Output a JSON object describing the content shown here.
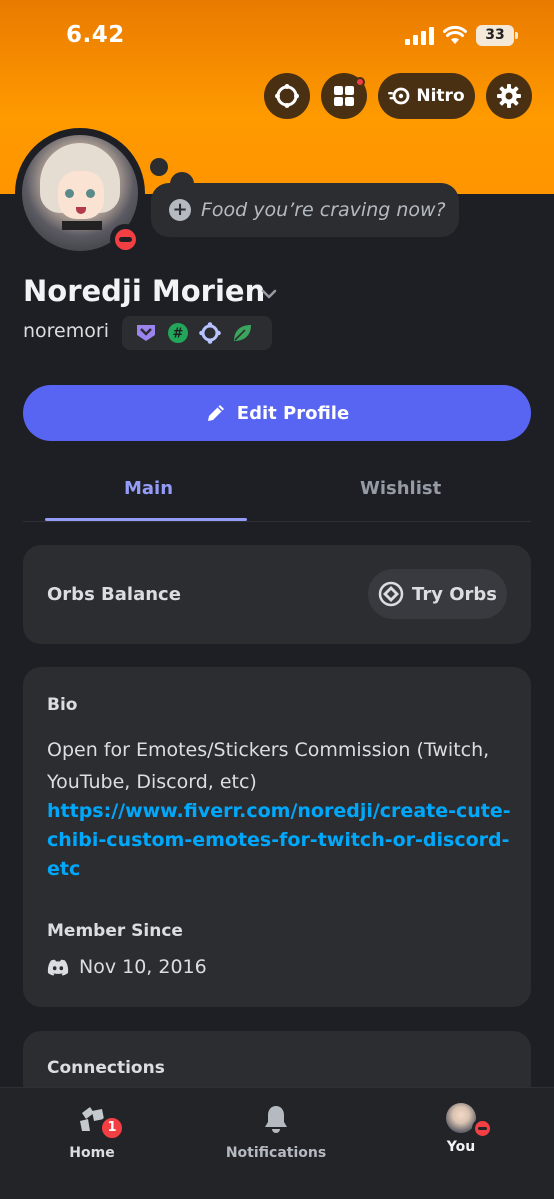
{
  "status_bar": {
    "time": "6.42",
    "battery": "33",
    "icons": [
      "signal-icon",
      "wifi-icon",
      "battery-icon"
    ]
  },
  "header_actions": {
    "icons": [
      "quests-icon",
      "shop-icon",
      "nitro-icon",
      "settings-icon"
    ],
    "nitro_label": "Nitro"
  },
  "profile": {
    "display_name": "Noredji Morien",
    "username": "noremori",
    "status_placeholder": "Food you’re craving now?",
    "presence": "do-not-disturb",
    "badges": [
      "hypesquad-badge-icon",
      "originally-known-badge-icon",
      "quest-badge-icon",
      "nitro-badge-icon"
    ]
  },
  "actions": {
    "edit_profile": "Edit Profile"
  },
  "tabs": {
    "main": "Main",
    "wishlist": "Wishlist",
    "active": "main"
  },
  "orbs": {
    "label": "Orbs Balance",
    "button": "Try Orbs"
  },
  "bio": {
    "title": "Bio",
    "text": "Open for Emotes/Stickers Commission (Twitch, YouTube, Discord, etc)",
    "link": "https://www.fiverr.com/noredji/create-cute-chibi-custom-emotes-for-twitch-or-discord-etc",
    "member_since_title": "Member Since",
    "member_since_date": "Nov 10, 2016"
  },
  "connections": {
    "title": "Connections"
  },
  "bottom_nav": {
    "home": "Home",
    "home_badge": "1",
    "notifications": "Notifications",
    "you": "You"
  },
  "colors": {
    "banner": "#ff9500",
    "accent": "#5865f2",
    "tab_active": "#949cf7",
    "link": "#00a8fc",
    "dnd": "#f23f43",
    "background": "#1e1f24",
    "card": "#2b2d31"
  }
}
